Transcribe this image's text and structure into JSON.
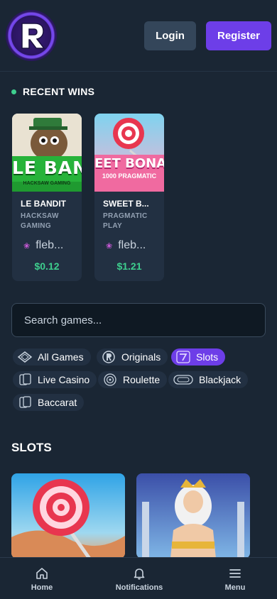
{
  "header": {
    "logo_letter": "R",
    "login_label": "Login",
    "register_label": "Register"
  },
  "recent_wins": {
    "title": "RECENT WINS",
    "items": [
      {
        "thumb_text": "LE BAND",
        "thumb_sub": "HACKSAW GAMING",
        "game": "LE BANDIT",
        "provider": "HACKSAW GAMING",
        "user": "fleb...",
        "amount": "$0.12"
      },
      {
        "thumb_text": "EET BONAN",
        "thumb_sub": "1000 PRAGMATIC",
        "game": "SWEET B...",
        "provider": "PRAGMATIC PLAY",
        "user": "fleb...",
        "amount": "$1.21"
      }
    ]
  },
  "search": {
    "placeholder": "Search games..."
  },
  "categories": [
    {
      "label": "All Games",
      "icon": "diamond-icon",
      "active": false
    },
    {
      "label": "Originals",
      "icon": "r-logo-icon",
      "active": false
    },
    {
      "label": "Slots",
      "icon": "seven-icon",
      "active": true
    },
    {
      "label": "Live Casino",
      "icon": "cards-icon",
      "active": false
    },
    {
      "label": "Roulette",
      "icon": "roulette-icon",
      "active": false
    },
    {
      "label": "Blackjack",
      "icon": "table-icon",
      "active": false
    },
    {
      "label": "Baccarat",
      "icon": "cards-icon",
      "active": false
    }
  ],
  "slots": {
    "title": "SLOTS"
  },
  "nav": {
    "home": "Home",
    "notifications": "Notifications",
    "menu": "Menu"
  },
  "colors": {
    "background": "#1a2634",
    "accent": "#6d3ee8",
    "win_green": "#3ecf8e",
    "card": "#223042"
  }
}
